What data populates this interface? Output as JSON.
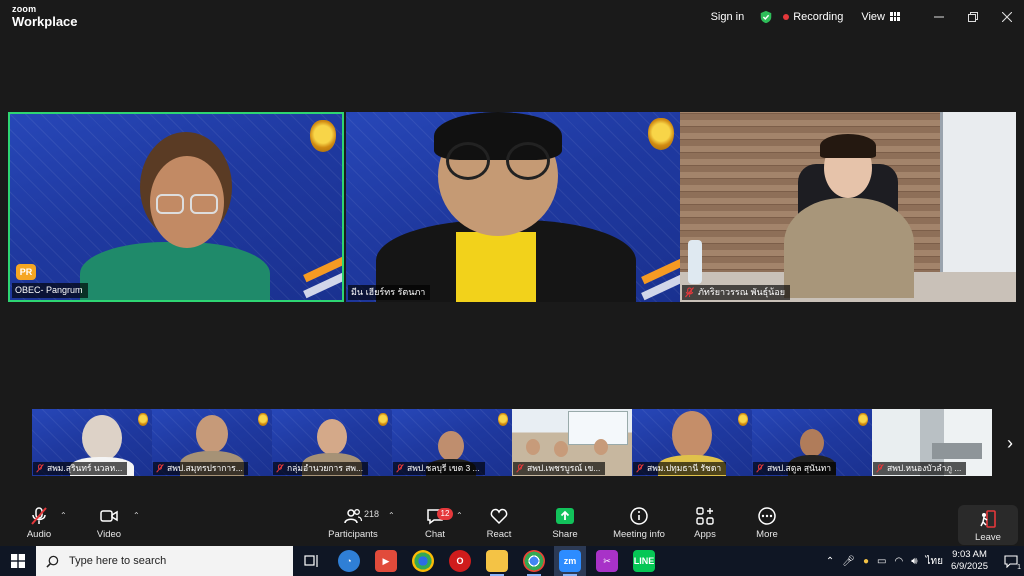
{
  "app": {
    "brand_top": "zoom",
    "brand_bottom": "Workplace",
    "signin_label": "Sign in",
    "recording_label": "Recording",
    "view_label": "View"
  },
  "main_videos": [
    {
      "name": "OBEC- Pangrum",
      "muted": false,
      "active_speaker": true
    },
    {
      "name": "มีน เฮียร์ทร รัตนภา",
      "muted": false,
      "active_speaker": false
    },
    {
      "name": "ภัทริยาวรรณ พันธุ์น้อย",
      "muted": true,
      "active_speaker": false
    }
  ],
  "gallery": [
    {
      "name": "สพม.สุรินทร์ นวลห..."
    },
    {
      "name": "สพป.สมุทรปราการ..."
    },
    {
      "name": "กลุ่มอำนวยการ สพ..."
    },
    {
      "name": "สพป.ชลบุรี เขต 3 ..."
    },
    {
      "name": "สพป.เพชรบูรณ์ เข..."
    },
    {
      "name": "สพม.ปทุมธานี รัชดา"
    },
    {
      "name": "สพป.สตูล สุนันทา"
    },
    {
      "name": "สพป.หนองบัวลำภู ..."
    }
  ],
  "toolbar": {
    "audio_label": "Audio",
    "video_label": "Video",
    "participants_label": "Participants",
    "participants_count": "218",
    "chat_label": "Chat",
    "chat_badge": "12",
    "react_label": "React",
    "share_label": "Share",
    "meeting_info_label": "Meeting info",
    "apps_label": "Apps",
    "more_label": "More",
    "leave_label": "Leave"
  },
  "taskbar": {
    "search_placeholder": "Type here to search",
    "language": "ไทย",
    "time": "9:03 AM",
    "date": "6/9/2025",
    "notification_count": "1"
  },
  "colors": {
    "active_border": "#2ed573",
    "recording_dot": "#e5383b",
    "share_green": "#12c25b",
    "muted_red": "#e5383b"
  }
}
